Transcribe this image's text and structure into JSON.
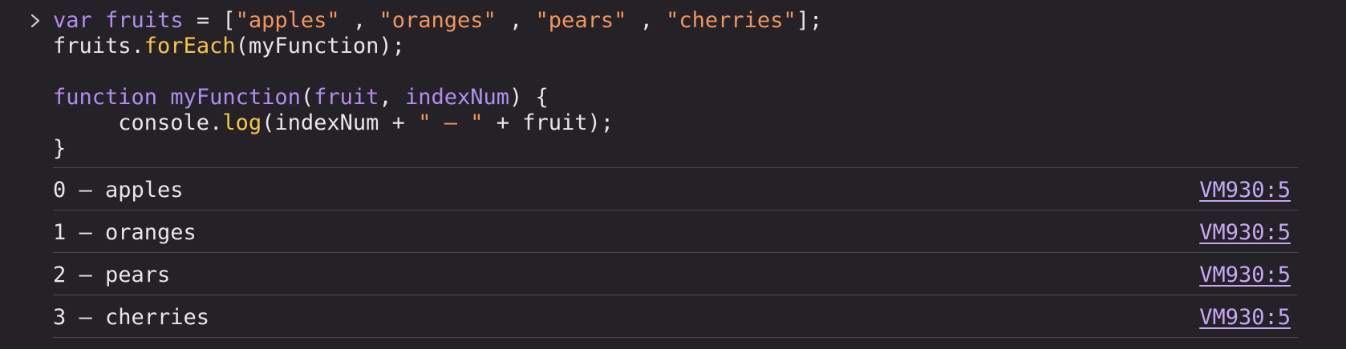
{
  "console": {
    "prompt_icon": "chevron-right-icon",
    "input_lines": [
      {
        "tokens": [
          {
            "t": "var",
            "c": "kw"
          },
          {
            "t": " ",
            "c": "plain"
          },
          {
            "t": "fruits",
            "c": "var"
          },
          {
            "t": " = [",
            "c": "plain"
          },
          {
            "t": "\"apples\"",
            "c": "str"
          },
          {
            "t": " , ",
            "c": "plain"
          },
          {
            "t": "\"oranges\"",
            "c": "str"
          },
          {
            "t": " , ",
            "c": "plain"
          },
          {
            "t": "\"pears\"",
            "c": "str"
          },
          {
            "t": " , ",
            "c": "plain"
          },
          {
            "t": "\"cherries\"",
            "c": "str"
          },
          {
            "t": "];",
            "c": "plain"
          }
        ]
      },
      {
        "tokens": [
          {
            "t": "fruits.",
            "c": "plain"
          },
          {
            "t": "forEach",
            "c": "fn"
          },
          {
            "t": "(myFunction);",
            "c": "plain"
          }
        ]
      },
      {
        "tokens": []
      },
      {
        "tokens": [
          {
            "t": "function",
            "c": "kw"
          },
          {
            "t": " ",
            "c": "plain"
          },
          {
            "t": "myFunction",
            "c": "var"
          },
          {
            "t": "(",
            "c": "plain"
          },
          {
            "t": "fruit",
            "c": "var"
          },
          {
            "t": ", ",
            "c": "plain"
          },
          {
            "t": "indexNum",
            "c": "var"
          },
          {
            "t": ") {",
            "c": "plain"
          }
        ]
      },
      {
        "tokens": [
          {
            "t": "     console.",
            "c": "plain"
          },
          {
            "t": "log",
            "c": "fn"
          },
          {
            "t": "(indexNum + ",
            "c": "plain"
          },
          {
            "t": "\" – \"",
            "c": "str"
          },
          {
            "t": " + fruit);",
            "c": "plain"
          }
        ]
      },
      {
        "tokens": [
          {
            "t": "}",
            "c": "plain"
          }
        ]
      }
    ],
    "output_rows": [
      {
        "message": "0 – apples",
        "source": "VM930:5"
      },
      {
        "message": "1 – oranges",
        "source": "VM930:5"
      },
      {
        "message": "2 – pears",
        "source": "VM930:5"
      },
      {
        "message": "3 – cherries",
        "source": "VM930:5"
      }
    ]
  }
}
